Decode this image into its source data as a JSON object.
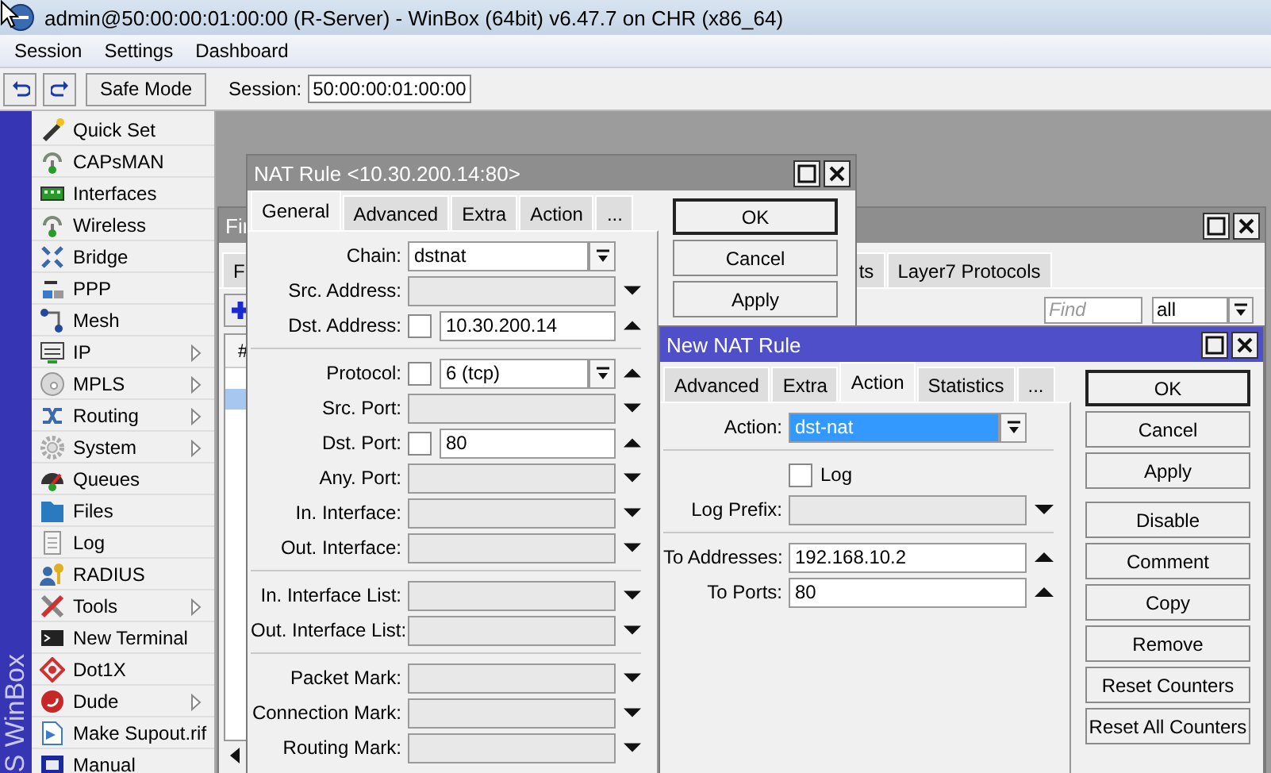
{
  "window": {
    "title": "admin@50:00:00:01:00:00 (R-Server) - WinBox (64bit) v6.47.7 on CHR (x86_64)"
  },
  "menu": [
    "Session",
    "Settings",
    "Dashboard"
  ],
  "toolbar": {
    "safe_mode": {
      "label": "Safe Mode",
      "on": false
    },
    "session_label": "Session:",
    "session_value": "50:00:00:01:00:00"
  },
  "sidebar": {
    "brand": "S WinBox",
    "items": [
      {
        "label": "Quick Set",
        "submenu": false
      },
      {
        "label": "CAPsMAN",
        "submenu": false
      },
      {
        "label": "Interfaces",
        "submenu": false
      },
      {
        "label": "Wireless",
        "submenu": false
      },
      {
        "label": "Bridge",
        "submenu": false
      },
      {
        "label": "PPP",
        "submenu": false
      },
      {
        "label": "Mesh",
        "submenu": false
      },
      {
        "label": "IP",
        "submenu": true
      },
      {
        "label": "MPLS",
        "submenu": true
      },
      {
        "label": "Routing",
        "submenu": true
      },
      {
        "label": "System",
        "submenu": true
      },
      {
        "label": "Queues",
        "submenu": false
      },
      {
        "label": "Files",
        "submenu": false
      },
      {
        "label": "Log",
        "submenu": false
      },
      {
        "label": "RADIUS",
        "submenu": false
      },
      {
        "label": "Tools",
        "submenu": true
      },
      {
        "label": "New Terminal",
        "submenu": false
      },
      {
        "label": "Dot1X",
        "submenu": false
      },
      {
        "label": "Dude",
        "submenu": true
      },
      {
        "label": "Make Supout.rif",
        "submenu": false
      },
      {
        "label": "Manual",
        "submenu": false
      }
    ]
  },
  "firewall_window": {
    "title": "Fir",
    "active": false,
    "tabs": [
      {
        "label": "F",
        "selected": false
      },
      {
        "label": "ts",
        "selected": false
      },
      {
        "label": "Layer7 Protocols",
        "selected": false
      }
    ],
    "find": {
      "placeholder": "Find"
    },
    "filter": "all",
    "table": {
      "columns": [
        "#"
      ],
      "rows": [
        {
          "selected": false
        },
        {
          "selected": true
        }
      ]
    }
  },
  "nat_rule_window": {
    "title": "NAT Rule <10.30.200.14:80>",
    "active": false,
    "tabs": [
      {
        "label": "General",
        "selected": true
      },
      {
        "label": "Advanced",
        "selected": false
      },
      {
        "label": "Extra",
        "selected": false
      },
      {
        "label": "Action",
        "selected": false
      },
      {
        "label": "...",
        "selected": false
      }
    ],
    "sections": [
      {
        "rows": [
          {
            "kind": "field",
            "label": "Chain:",
            "value": "dstnat",
            "dropdown": true
          },
          {
            "kind": "field",
            "label": "Src. Address:",
            "expanded": false
          },
          {
            "kind": "field",
            "label": "Dst. Address:",
            "negate": {
              "checked": false
            },
            "value": "10.30.200.14",
            "expanded": true
          }
        ]
      },
      {
        "rows": [
          {
            "kind": "field",
            "label": "Protocol:",
            "negate": {
              "checked": false
            },
            "value": "6 (tcp)",
            "dropdown": true,
            "expanded": true
          },
          {
            "kind": "field",
            "label": "Src. Port:",
            "expanded": false
          },
          {
            "kind": "field",
            "label": "Dst. Port:",
            "negate": {
              "checked": false
            },
            "value": "80",
            "expanded": true
          },
          {
            "kind": "field",
            "label": "Any. Port:",
            "expanded": false
          },
          {
            "kind": "field",
            "label": "In. Interface:",
            "expanded": false
          },
          {
            "kind": "field",
            "label": "Out. Interface:",
            "expanded": false
          }
        ]
      },
      {
        "rows": [
          {
            "kind": "field",
            "label": "In. Interface List:",
            "expanded": false
          },
          {
            "kind": "field",
            "label": "Out. Interface List:",
            "expanded": false
          }
        ]
      },
      {
        "rows": [
          {
            "kind": "field",
            "label": "Packet Mark:",
            "expanded": false
          },
          {
            "kind": "field",
            "label": "Connection Mark:",
            "expanded": false
          },
          {
            "kind": "field",
            "label": "Routing Mark:",
            "expanded": false
          }
        ]
      }
    ],
    "buttons": [
      {
        "label": "OK",
        "default": true
      },
      {
        "label": "Cancel",
        "default": false
      },
      {
        "label": "Apply",
        "default": false
      }
    ]
  },
  "new_nat_rule_window": {
    "title": "New NAT Rule",
    "active": true,
    "tabs": [
      {
        "label": "Advanced",
        "selected": false
      },
      {
        "label": "Extra",
        "selected": false
      },
      {
        "label": "Action",
        "selected": true
      },
      {
        "label": "Statistics",
        "selected": false
      },
      {
        "label": "...",
        "selected": false
      }
    ],
    "sections": [
      {
        "rows": [
          {
            "kind": "field",
            "label": "Action:",
            "value": "dst-nat",
            "highlighted": true,
            "dropdown": true
          }
        ]
      },
      {
        "rows": [
          {
            "kind": "checkbox",
            "label": "Log",
            "checked": false
          },
          {
            "kind": "field",
            "label": "Log Prefix:",
            "expanded": false
          }
        ]
      },
      {
        "rows": [
          {
            "kind": "field",
            "label": "To Addresses:",
            "value": "192.168.10.2",
            "expanded": true
          },
          {
            "kind": "field",
            "label": "To Ports:",
            "value": "80",
            "expanded": true
          }
        ]
      }
    ],
    "buttons": [
      {
        "label": "OK",
        "default": true
      },
      {
        "label": "Cancel",
        "default": false
      },
      {
        "label": "Apply",
        "default": false
      },
      {
        "label": "Disable",
        "default": false
      },
      {
        "label": "Comment",
        "default": false
      },
      {
        "label": "Copy",
        "default": false
      },
      {
        "label": "Remove",
        "default": false
      },
      {
        "label": "Reset Counters",
        "default": false
      },
      {
        "label": "Reset All Counters",
        "default": false
      }
    ]
  }
}
